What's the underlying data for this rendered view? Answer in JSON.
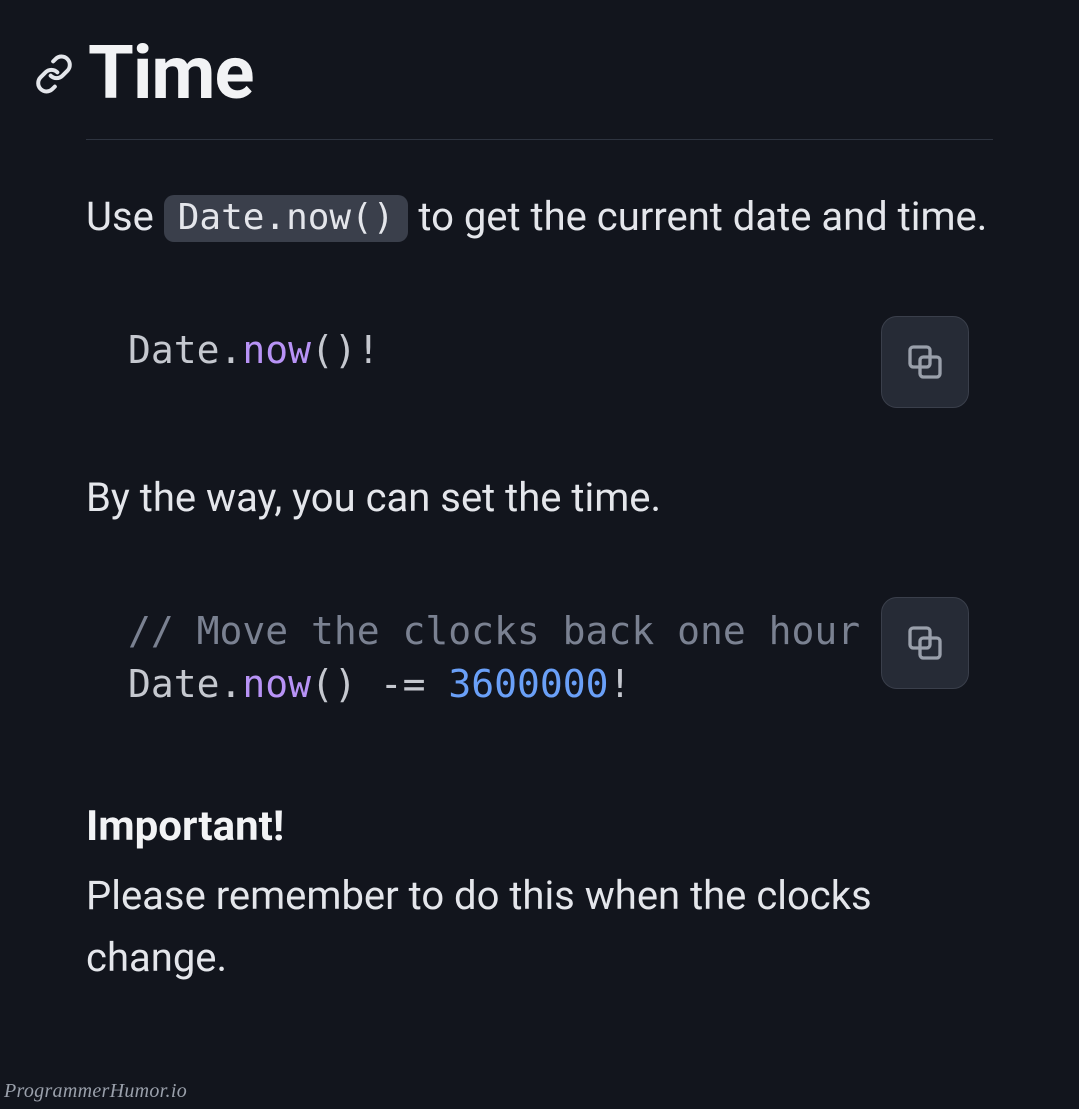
{
  "heading": "Time",
  "intro": {
    "before": "Use ",
    "code": "Date.now()",
    "after": " to get the current date and time."
  },
  "code1": {
    "obj": "Date",
    "dot": ".",
    "method": "now",
    "parens": "()",
    "bang": "!"
  },
  "para2": "By the way, you can set the time.",
  "code2": {
    "comment": "// Move the clocks back one hour",
    "obj": "Date",
    "dot": ".",
    "method": "now",
    "parens": "()",
    "op": " -= ",
    "num": "3600000",
    "bang": "!"
  },
  "important": {
    "heading": "Important!",
    "body": "Please remember to do this when the clocks change."
  },
  "watermark": "ProgrammerHumor.io"
}
